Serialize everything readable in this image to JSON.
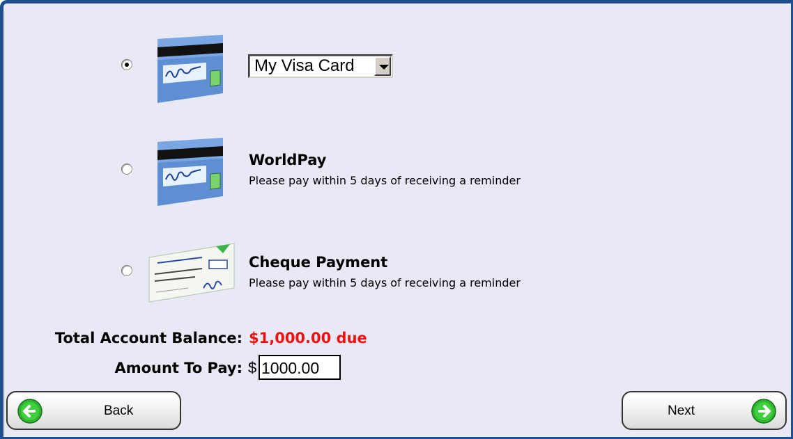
{
  "payment_options": [
    {
      "id": "visa",
      "selected": true,
      "icon": "credit-card-icon",
      "select_value": "My Visa Card"
    },
    {
      "id": "worldpay",
      "selected": false,
      "icon": "credit-card-icon",
      "title": "WorldPay",
      "description": "Please pay within 5 days of receiving a reminder"
    },
    {
      "id": "cheque",
      "selected": false,
      "icon": "cheque-icon",
      "title": "Cheque Payment",
      "description": "Please pay within 5 days of receiving a reminder"
    }
  ],
  "balance": {
    "label": "Total Account Balance:",
    "value": "$1,000.00 due",
    "value_color": "#ee1111"
  },
  "amount_to_pay": {
    "label": "Amount To Pay:",
    "currency": "$",
    "value": "1000.00"
  },
  "buttons": {
    "back": "Back",
    "next": "Next"
  },
  "colors": {
    "panel_bg": "#e9e9f6",
    "border": "#1f4f8f",
    "arrow_green": "#2fb52f"
  }
}
